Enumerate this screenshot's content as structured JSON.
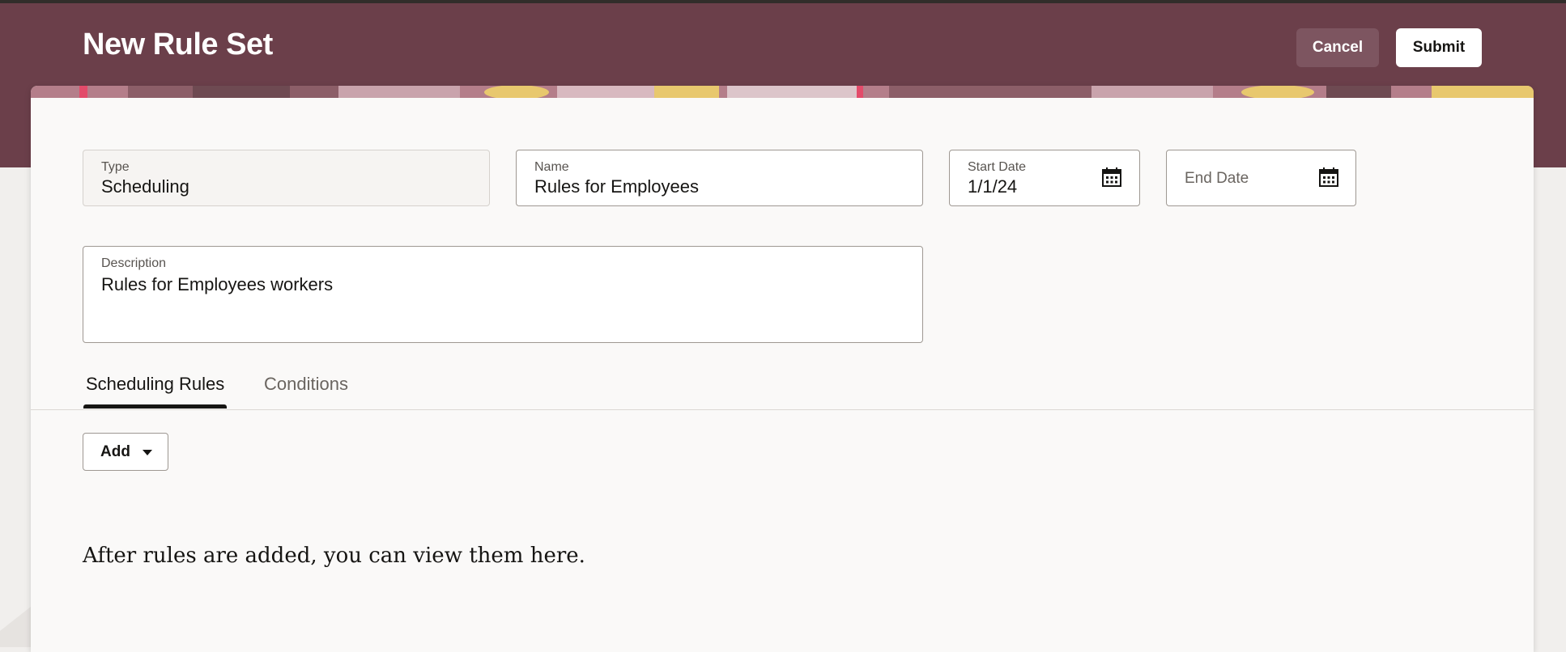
{
  "header": {
    "title": "New Rule Set",
    "cancel_label": "Cancel",
    "submit_label": "Submit"
  },
  "form": {
    "type": {
      "label": "Type",
      "value": "Scheduling"
    },
    "name": {
      "label": "Name",
      "value": "Rules for Employees"
    },
    "start_date": {
      "label": "Start Date",
      "value": "1/1/24",
      "icon": "calendar-icon"
    },
    "end_date": {
      "placeholder": "End Date",
      "icon": "calendar-icon"
    },
    "description": {
      "label": "Description",
      "value": "Rules for Employees workers"
    }
  },
  "tabs": [
    {
      "label": "Scheduling Rules",
      "active": true
    },
    {
      "label": "Conditions",
      "active": false
    }
  ],
  "toolbar": {
    "add_label": "Add",
    "add_icon": "chevron-down-icon"
  },
  "empty_state": {
    "message": "After rules are added, you can view them here."
  },
  "colors": {
    "header_bg": "#6b3f4a",
    "card_bg": "#faf9f8",
    "page_bg": "#f1efed",
    "accent_yellow": "#e8c86e",
    "accent_pink": "#d98a9e"
  }
}
